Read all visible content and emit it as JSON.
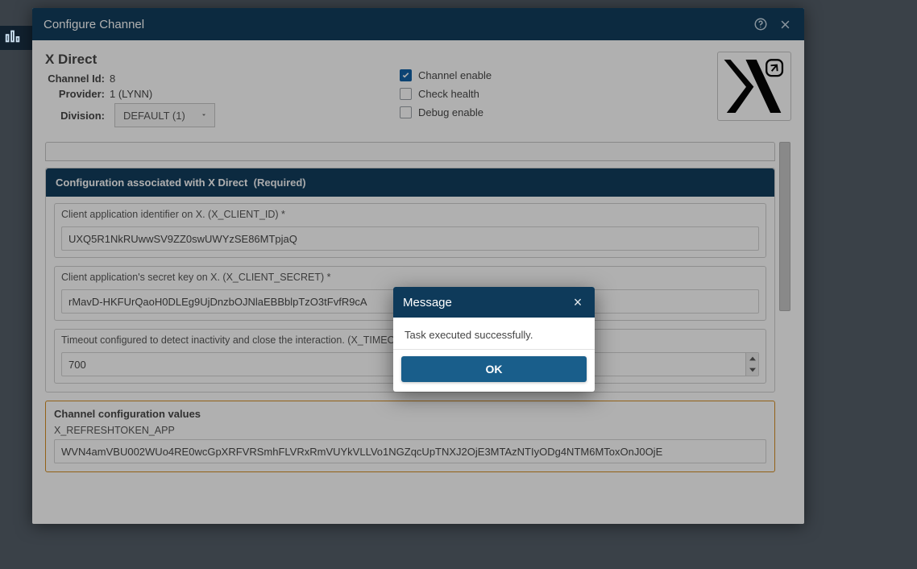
{
  "sidebar": {
    "icon": "bar-chart"
  },
  "panel": {
    "title": "Configure Channel",
    "channel_name": "X Direct",
    "labels": {
      "channel_id": "Channel Id:",
      "provider": "Provider:",
      "division": "Division:"
    },
    "channel_id": "8",
    "provider": "1 (LYNN)",
    "division_select": "DEFAULT (1)",
    "checks": {
      "enable": "Channel enable",
      "health": "Check health",
      "debug": "Debug enable"
    },
    "checks_state": {
      "enable": true,
      "health": false,
      "debug": false
    }
  },
  "sections": {
    "required": {
      "title": "Configuration associated with X Direct",
      "req": "(Required)"
    },
    "fields": {
      "client_id": {
        "label": "Client application identifier on X. (X_CLIENT_ID) *",
        "value": "UXQ5R1NkRUwwSV9ZZ0swUWYzSE86MTpjaQ"
      },
      "client_secret": {
        "label": "Client application's secret key on X. (X_CLIENT_SECRET) *",
        "value": "rMavD-HKFUrQaoH0DLEg9UjDnzbOJNlaEBBblpTzO3tFvfR9cA"
      },
      "timeout": {
        "label": "Timeout configured to detect inactivity and close the interaction. (X_TIMEOUT_",
        "value": "700"
      }
    },
    "amber": {
      "title": "Channel configuration values",
      "token_label": "X_REFRESHTOKEN_APP",
      "token_value": "WVN4amVBU002WUo4RE0wcGpXRFVRSmhFLVRxRmVUYkVLLVo1NGZqcUpTNXJ2OjE3MTAzNTIyODg4NTM6MToxOnJ0OjE"
    }
  },
  "modal": {
    "title": "Message",
    "body": "Task executed successfully.",
    "ok": "OK"
  }
}
